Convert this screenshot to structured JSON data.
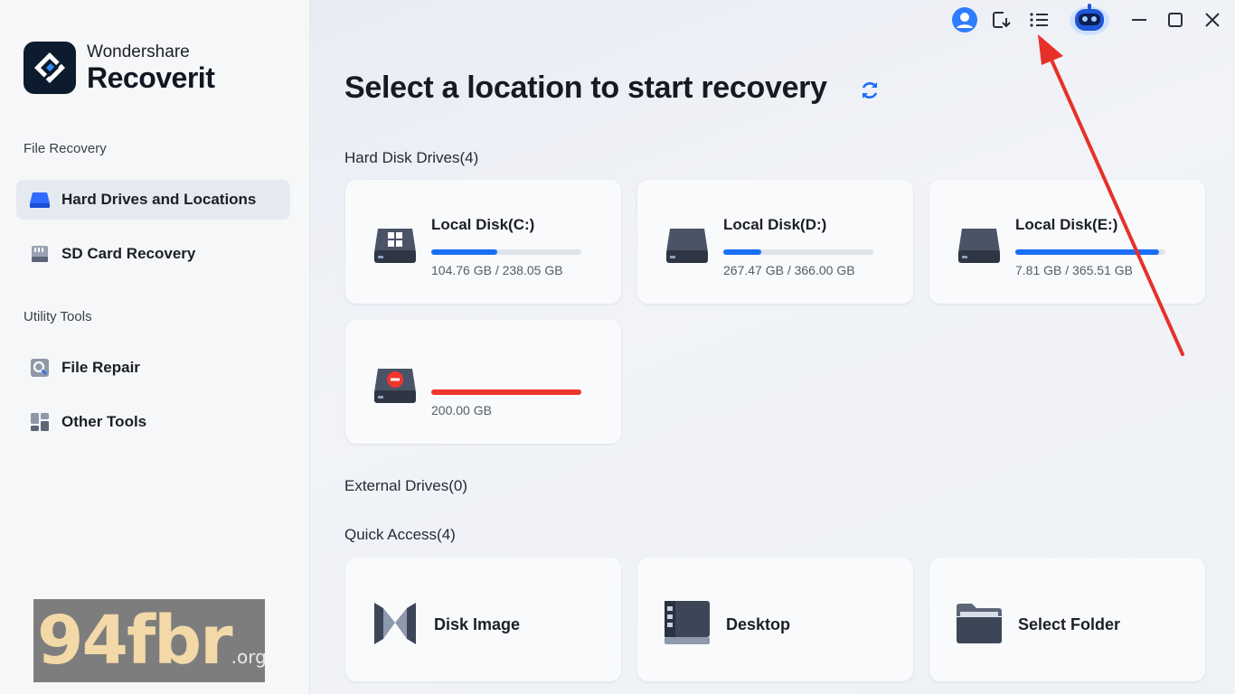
{
  "app": {
    "brand": "Wondershare",
    "product": "Recoverit"
  },
  "sidebar": {
    "sections": [
      {
        "label": "File Recovery"
      },
      {
        "label": "Utility Tools"
      }
    ],
    "items": [
      {
        "label": "Hard Drives and Locations",
        "icon": "hard-drive-icon",
        "active": true
      },
      {
        "label": "SD Card Recovery",
        "icon": "sd-card-icon",
        "active": false
      },
      {
        "label": "File Repair",
        "icon": "file-repair-icon",
        "active": false
      },
      {
        "label": "Other Tools",
        "icon": "grid-tools-icon",
        "active": false
      }
    ]
  },
  "topbar": {
    "icons": [
      "user-account-icon",
      "export-icon",
      "menu-list-icon",
      "robot-assistant-icon",
      "minimize-icon",
      "maximize-icon",
      "close-icon"
    ]
  },
  "main": {
    "title": "Select a location to start recovery",
    "hard_disk_label": "Hard Disk Drives(4)",
    "disks": [
      {
        "name": "Local Disk(C:)",
        "size": "104.76 GB / 238.05 GB",
        "used_fraction": 0.44,
        "bar_color": "#1a6ef5",
        "icon": "windows-disk-icon"
      },
      {
        "name": "Local Disk(D:)",
        "size": "267.47 GB / 366.00 GB",
        "used_fraction": 0.25,
        "bar_color": "#1a6ef5",
        "icon": "disk-icon"
      },
      {
        "name": "Local Disk(E:)",
        "size": "7.81 GB / 365.51 GB",
        "used_fraction": 0.96,
        "bar_color": "#1a6ef5",
        "icon": "disk-icon"
      },
      {
        "name": "",
        "size": "200.00 GB",
        "used_fraction": 1.0,
        "bar_color": "#f0352c",
        "icon": "lost-partition-disk-icon"
      }
    ],
    "external_label": "External Drives(0)",
    "quick_access_label": "Quick Access(4)",
    "quick_access": [
      {
        "label": "Disk Image",
        "icon": "disk-image-icon"
      },
      {
        "label": "Desktop",
        "icon": "desktop-icon"
      },
      {
        "label": "Select Folder",
        "icon": "folder-icon"
      }
    ]
  },
  "watermark": {
    "main": "94fbr",
    "tld": ".org"
  },
  "colors": {
    "accent": "#1a6ef5",
    "danger": "#f0352c",
    "annotation_arrow": "#e8302a"
  }
}
